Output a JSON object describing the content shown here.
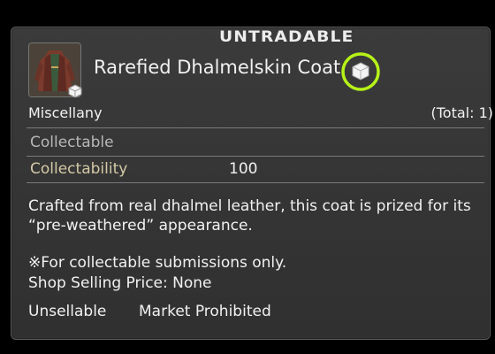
{
  "tooltip": {
    "tradability": "UNTRADABLE",
    "item_name": "Rarefied Dhalmelskin Coat",
    "item_icon": "dhalmelskin-coat-icon",
    "collectable_marker_icon": "collectable-cube-icon",
    "category": "Miscellany",
    "total": "(Total: 1)",
    "collectable_label": "Collectable",
    "collectability_label": "Collectability",
    "collectability_value": "100",
    "description": "Crafted from real dhalmel leather, this coat is prized for its “pre-weathered” appearance.",
    "note": "※For collectable submissions only.",
    "shop_price": "Shop Selling Price: None",
    "unsellable": "Unsellable",
    "market": "Market Prohibited",
    "highlight_color": "#b6f218",
    "collectability_color": "#d4c9a6"
  }
}
